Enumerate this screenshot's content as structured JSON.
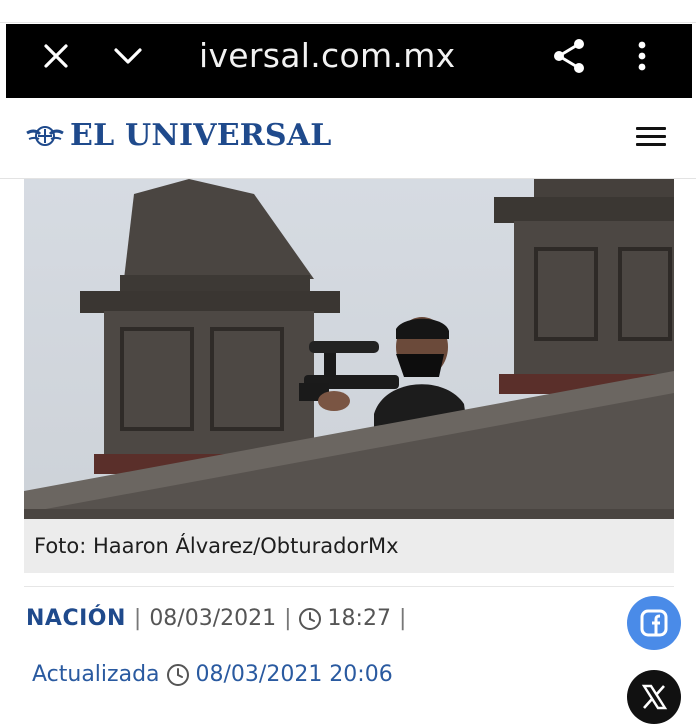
{
  "browser": {
    "url": "iversal.com.mx",
    "icons": [
      "close-icon",
      "chevron-down-icon",
      "share-icon",
      "more-vert-icon"
    ]
  },
  "header": {
    "logo_text": "EL UNIVERSAL",
    "brand_color": "#1f4a8c",
    "menu_icon": "hamburger-menu-icon"
  },
  "article": {
    "photo_caption": "Foto: Haaron Álvarez/ObturadorMx",
    "section": "NACIÓN",
    "date": "08/03/2021",
    "time": "18:27",
    "updated_label": "Actualizada",
    "updated_datetime": "08/03/2021 20:06"
  },
  "social": {
    "facebook_color": "#4a8be8",
    "x_color": "#111111"
  }
}
